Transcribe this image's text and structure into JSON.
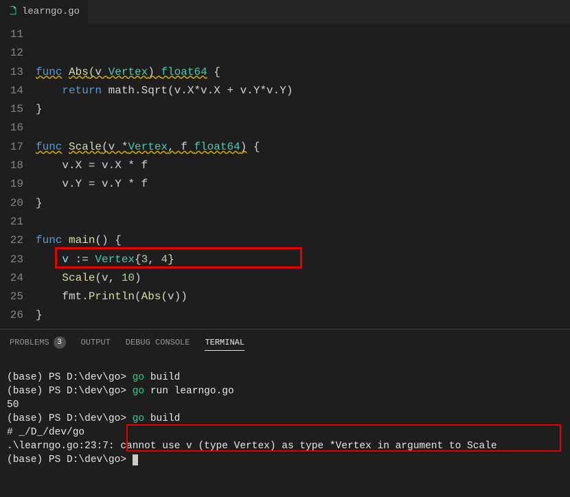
{
  "tab": {
    "filename": "learngo.go"
  },
  "gutter": {
    "start": 11,
    "end": 26
  },
  "code": {
    "l12": {
      "kw": "func",
      "name": "Abs",
      "sig1": "(v ",
      "vtype": "Vertex",
      "sig2": ") ",
      "ret": "float64",
      "brace": " {"
    },
    "l13": {
      "kw": "return",
      "rest": " math.Sqrt(v.X*v.X + v.Y*v.Y)"
    },
    "l14": {
      "brace": "}"
    },
    "l16": {
      "kw": "func",
      "name": "Scale",
      "sig1": "(v *",
      "vtype": "Vertex",
      "sig2": ", f ",
      "ftype": "float64",
      "sig3": ")",
      "brace": " {"
    },
    "l17": {
      "body": "v.X = v.X * f"
    },
    "l18": {
      "body": "v.Y = v.Y * f"
    },
    "l19": {
      "brace": "}"
    },
    "l21": {
      "kw": "func",
      "name": "main",
      "sig": "() {"
    },
    "l22": {
      "lhs": "v",
      "op": " := ",
      "ctor": "Vertex",
      "args1": "{",
      "n1": "3",
      "c": ", ",
      "n2": "4",
      "args2": "}"
    },
    "l23": {
      "fn": "Scale",
      "args1": "(v, ",
      "n": "10",
      "args2": ")"
    },
    "l24": {
      "pkg": "fmt.",
      "fn": "Println",
      "args1": "(",
      "fn2": "Abs",
      "args2": "(v))"
    },
    "l25": {
      "brace": "}"
    }
  },
  "panel": {
    "tabs": {
      "problems_label": "PROBLEMS",
      "problems_count": "3",
      "output_label": "OUTPUT",
      "debug_label": "DEBUG CONSOLE",
      "terminal_label": "TERMINAL"
    },
    "terminal": {
      "line1": {
        "prompt": "(base) PS D:\\dev\\go> ",
        "cmd": "go",
        "args": " build"
      },
      "line2": {
        "prompt": "(base) PS D:\\dev\\go> ",
        "cmd": "go",
        "args": " run learngo.go"
      },
      "line3": "50",
      "line4": {
        "prompt": "(base) PS D:\\dev\\go> ",
        "cmd": "go",
        "args": " build"
      },
      "line5": "# _/D_/dev/go",
      "line6": {
        "loc": ".\\learngo.go:23:7: ",
        "msg": "cannot use v (type Vertex) as type *Vertex in argument to Scale"
      },
      "line7": {
        "prompt": "(base) PS D:\\dev\\go> "
      }
    }
  }
}
